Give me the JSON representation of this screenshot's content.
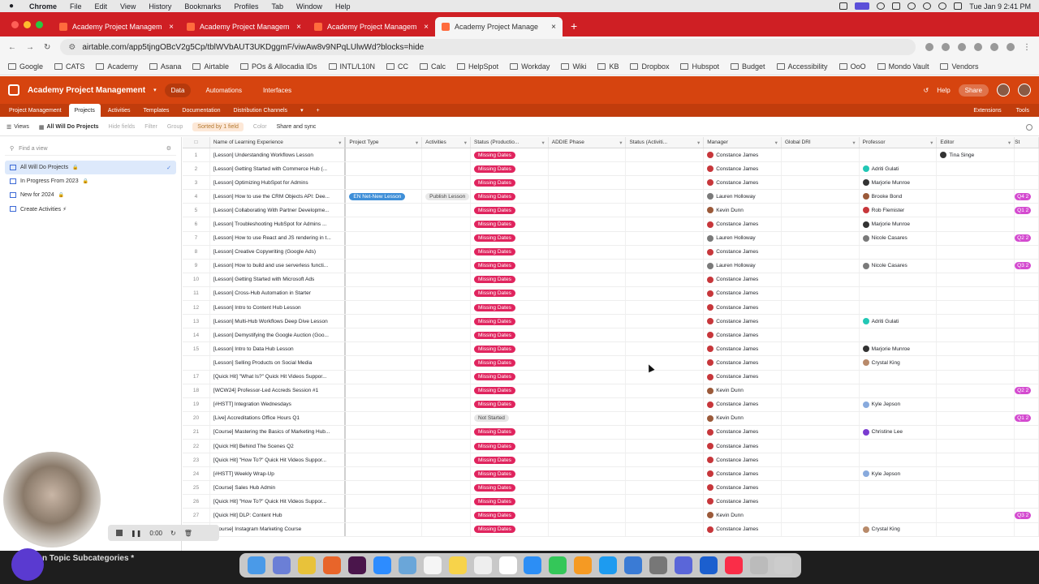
{
  "menubar": {
    "apple": "",
    "app": "Chrome",
    "items": [
      "File",
      "Edit",
      "View",
      "History",
      "Bookmarks",
      "Profiles",
      "Tab",
      "Window",
      "Help"
    ],
    "datetime": "Tue Jan 9  2:41 PM"
  },
  "browser": {
    "tabs": [
      {
        "title": "Academy Project Managem",
        "active": false
      },
      {
        "title": "Academy Project Managem",
        "active": false
      },
      {
        "title": "Academy Project Managem",
        "active": false
      },
      {
        "title": "Academy Project Manage",
        "active": true
      }
    ],
    "url": "airtable.com/app5tjngOBcV2g5Cp/tblWVbAUT3UKDggmF/viwAw8v9NPqLUlwWd?blocks=hide",
    "bookmarks": [
      "Google",
      "CATS",
      "Academy",
      "Asana",
      "Airtable",
      "POs & Allocadia IDs",
      "INTL/L10N",
      "CC",
      "Calc",
      "HelpSpot",
      "Workday",
      "Wiki",
      "KB",
      "Dropbox",
      "Hubspot",
      "Budget",
      "Accessibility",
      "OoO",
      "Mondo Vault",
      "Vendors"
    ]
  },
  "airtable": {
    "base_name": "Academy Project Management",
    "header_tabs": [
      "Data",
      "Automations",
      "Interfaces"
    ],
    "help": "Help",
    "share": "Share",
    "tables": [
      "Project Management",
      "Projects",
      "Activities",
      "Templates",
      "Documentation",
      "Distribution Channels"
    ],
    "tables_right": [
      "Extensions",
      "Tools"
    ],
    "toolbar": {
      "views": "Views",
      "current_view": "All Will Do Projects",
      "hide_fields": "Hide fields",
      "filter": "Filter",
      "group": "Group",
      "sorted": "Sorted by 1 field",
      "color": "Color",
      "share_sync": "Share and sync"
    },
    "sidebar": {
      "find_placeholder": "Find a view",
      "views": [
        {
          "label": "All Will Do Projects",
          "active": true
        },
        {
          "label": "In Progress From 2023",
          "active": false
        },
        {
          "label": "New for 2024",
          "active": false
        },
        {
          "label": "Create Activities ⚡",
          "active": false
        }
      ]
    },
    "columns": [
      "Name of Learning Experience",
      "Project Type",
      "Activities",
      "Status (Productio...",
      "ADDIE Phase",
      "Status (Activiti...",
      "Manager",
      "Global DRI",
      "Professor",
      "Editor",
      "St"
    ],
    "rows": [
      {
        "n": "1",
        "name": "[Lesson] Understanding Workflows Lesson",
        "ptype": "",
        "act": "",
        "status": "Missing Dates",
        "mgr": "Constance James",
        "mgr_c": "red",
        "prof": "",
        "prof_c": "",
        "editor": "Tina Singe",
        "q": ""
      },
      {
        "n": "2",
        "name": "[Lesson] Getting Started with Commerce Hub (...",
        "ptype": "",
        "act": "",
        "status": "Missing Dates",
        "mgr": "Constance James",
        "mgr_c": "red",
        "prof": "Adriti Gulati",
        "prof_c": "teal",
        "editor": "",
        "q": ""
      },
      {
        "n": "3",
        "name": "[Lesson] Optimizing HubSpot for Admins",
        "ptype": "",
        "act": "",
        "status": "Missing Dates",
        "mgr": "Constance James",
        "mgr_c": "red",
        "prof": "Marjorie Munroe",
        "prof_c": "dark",
        "editor": "",
        "q": ""
      },
      {
        "n": "4",
        "name": "[Lesson] How to use the CRM Objects API: Dee...",
        "ptype": "EN Net-New Lesson",
        "act": "Publish Lesson",
        "status": "Missing Dates",
        "mgr": "Lauren Holloway",
        "mgr_c": "gray",
        "prof": "Brooke Bond",
        "prof_c": "brown",
        "editor": "",
        "q": "Q4 2"
      },
      {
        "n": "5",
        "name": "[Lesson] Collaborating With Partner Developme...",
        "ptype": "",
        "act": "",
        "status": "Missing Dates",
        "mgr": "Kevin Dunn",
        "mgr_c": "brown",
        "prof": "Rob Flemister",
        "prof_c": "red",
        "editor": "",
        "q": "Q1 2"
      },
      {
        "n": "6",
        "name": "[Lesson] Troubleshooting HubSpot for Admins ...",
        "ptype": "",
        "act": "",
        "status": "Missing Dates",
        "mgr": "Constance James",
        "mgr_c": "red",
        "prof": "Marjorie Munroe",
        "prof_c": "dark",
        "editor": "",
        "q": ""
      },
      {
        "n": "7",
        "name": "[Lesson] How to use React and JS rendering in t...",
        "ptype": "",
        "act": "",
        "status": "Missing Dates",
        "mgr": "Lauren Holloway",
        "mgr_c": "gray",
        "prof": "Nicole Casares",
        "prof_c": "gray",
        "editor": "",
        "q": "Q2 2"
      },
      {
        "n": "8",
        "name": "[Lesson] Creative Copywriting (Google Ads)",
        "ptype": "",
        "act": "",
        "status": "Missing Dates",
        "mgr": "Constance James",
        "mgr_c": "red",
        "prof": "",
        "prof_c": "",
        "editor": "",
        "q": ""
      },
      {
        "n": "9",
        "name": "[Lesson] How to build and use serverless functi...",
        "ptype": "",
        "act": "",
        "status": "Missing Dates",
        "mgr": "Lauren Holloway",
        "mgr_c": "gray",
        "prof": "Nicole Casares",
        "prof_c": "gray",
        "editor": "",
        "q": "Q3 2"
      },
      {
        "n": "10",
        "name": "[Lesson] Getting Started with Microsoft Ads",
        "ptype": "",
        "act": "",
        "status": "Missing Dates",
        "mgr": "Constance James",
        "mgr_c": "red",
        "prof": "",
        "prof_c": "",
        "editor": "",
        "q": ""
      },
      {
        "n": "11",
        "name": "[Lesson] Cross-Hub Automation in Starter",
        "ptype": "",
        "act": "",
        "status": "Missing Dates",
        "mgr": "Constance James",
        "mgr_c": "red",
        "prof": "",
        "prof_c": "",
        "editor": "",
        "q": ""
      },
      {
        "n": "12",
        "name": "[Lesson] Intro to Content Hub Lesson",
        "ptype": "",
        "act": "",
        "status": "Missing Dates",
        "mgr": "Constance James",
        "mgr_c": "red",
        "prof": "",
        "prof_c": "",
        "editor": "",
        "q": ""
      },
      {
        "n": "13",
        "name": "[Lesson] Multi-Hub Workflows Deep Dive Lesson",
        "ptype": "",
        "act": "",
        "status": "Missing Dates",
        "mgr": "Constance James",
        "mgr_c": "red",
        "prof": "Adriti Gulati",
        "prof_c": "teal",
        "editor": "",
        "q": ""
      },
      {
        "n": "14",
        "name": "[Lesson] Demystifying the Google Auction (Goo...",
        "ptype": "",
        "act": "",
        "status": "Missing Dates",
        "mgr": "Constance James",
        "mgr_c": "red",
        "prof": "",
        "prof_c": "",
        "editor": "",
        "q": ""
      },
      {
        "n": "15",
        "name": "[Lesson] Intro to Data Hub Lesson",
        "ptype": "",
        "act": "",
        "status": "Missing Dates",
        "mgr": "Constance James",
        "mgr_c": "red",
        "prof": "Marjorie Munroe",
        "prof_c": "dark",
        "editor": "",
        "q": ""
      },
      {
        "n": "",
        "name": "[Lesson] Selling Products on Social Media",
        "ptype": "",
        "act": "",
        "status": "Missing Dates",
        "mgr": "Constance James",
        "mgr_c": "red",
        "prof": "Crystal King",
        "prof_c": "tan",
        "editor": "",
        "q": ""
      },
      {
        "n": "17",
        "name": "[Quick Hit] \"What Is?\" Quick Hit Videos Suppor...",
        "ptype": "",
        "act": "",
        "status": "Missing Dates",
        "mgr": "Constance James",
        "mgr_c": "red",
        "prof": "",
        "prof_c": "",
        "editor": "",
        "q": ""
      },
      {
        "n": "18",
        "name": "[WCW24] Professor-Led Accreds Session #1",
        "ptype": "",
        "act": "",
        "status": "Missing Dates",
        "mgr": "Kevin Dunn",
        "mgr_c": "brown",
        "prof": "",
        "prof_c": "",
        "editor": "",
        "q": "Q2 2"
      },
      {
        "n": "19",
        "name": "[#HSTT] Integration Wednesdays",
        "ptype": "",
        "act": "",
        "status": "Missing Dates",
        "mgr": "Constance James",
        "mgr_c": "red",
        "prof": "Kyle Jepson",
        "prof_c": "light",
        "editor": "",
        "q": ""
      },
      {
        "n": "20",
        "name": "[Live] Accreditations Office Hours Q1",
        "ptype": "",
        "act": "",
        "status": "Not Started",
        "mgr": "Kevin Dunn",
        "mgr_c": "brown",
        "prof": "",
        "prof_c": "",
        "editor": "",
        "q": "Q1 2"
      },
      {
        "n": "21",
        "name": "[Course] Mastering the Basics of Marketing Hub...",
        "ptype": "",
        "act": "",
        "status": "Missing Dates",
        "mgr": "Constance James",
        "mgr_c": "red",
        "prof": "Christine Lee",
        "prof_c": "purple",
        "editor": "",
        "q": ""
      },
      {
        "n": "22",
        "name": "[Quick Hit] Behind The Scenes Q2",
        "ptype": "",
        "act": "",
        "status": "Missing Dates",
        "mgr": "Constance James",
        "mgr_c": "red",
        "prof": "",
        "prof_c": "",
        "editor": "",
        "q": ""
      },
      {
        "n": "23",
        "name": "[Quick Hit] \"How To?\" Quick Hit Videos Suppor...",
        "ptype": "",
        "act": "",
        "status": "Missing Dates",
        "mgr": "Constance James",
        "mgr_c": "red",
        "prof": "",
        "prof_c": "",
        "editor": "",
        "q": ""
      },
      {
        "n": "24",
        "name": "[#HSTT] Weekly Wrap-Up",
        "ptype": "",
        "act": "",
        "status": "Missing Dates",
        "mgr": "Constance James",
        "mgr_c": "red",
        "prof": "Kyle Jepson",
        "prof_c": "light",
        "editor": "",
        "q": ""
      },
      {
        "n": "25",
        "name": "[Course] Sales Hub Admin",
        "ptype": "",
        "act": "",
        "status": "Missing Dates",
        "mgr": "Constance James",
        "mgr_c": "red",
        "prof": "",
        "prof_c": "",
        "editor": "",
        "q": ""
      },
      {
        "n": "26",
        "name": "[Quick Hit] \"How To?\" Quick Hit Videos Suppor...",
        "ptype": "",
        "act": "",
        "status": "Missing Dates",
        "mgr": "Constance James",
        "mgr_c": "red",
        "prof": "",
        "prof_c": "",
        "editor": "",
        "q": ""
      },
      {
        "n": "27",
        "name": "[Quick Hit] DLP: Content Hub",
        "ptype": "",
        "act": "",
        "status": "Missing Dates",
        "mgr": "Kevin Dunn",
        "mgr_c": "brown",
        "prof": "",
        "prof_c": "",
        "editor": "",
        "q": "Q3 2"
      },
      {
        "n": "",
        "name": "[Course] Instagram Marketing Course",
        "ptype": "",
        "act": "",
        "status": "Missing Dates",
        "mgr": "Constance James",
        "mgr_c": "red",
        "prof": "Crystal King",
        "prof_c": "tan",
        "editor": "",
        "q": ""
      }
    ]
  },
  "overlay": {
    "recording_time": "0:00",
    "behind_text": "n Topic Subcategories *"
  },
  "colors": {
    "tabbar": "#cf1f24",
    "airtable_header": "#d6440f",
    "missing_dates": "#e0245e"
  }
}
